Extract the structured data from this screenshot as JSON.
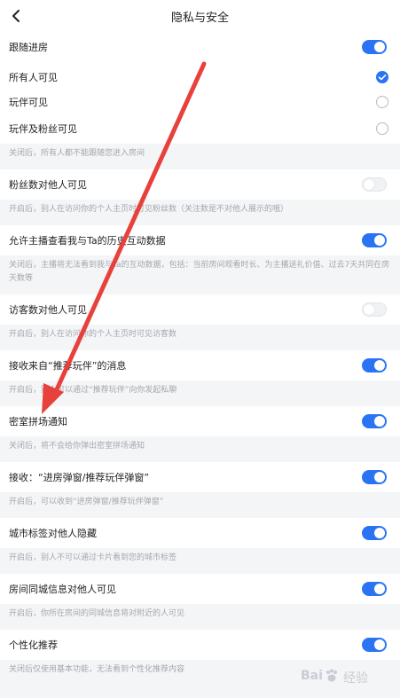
{
  "header": {
    "title": "隐私与安全",
    "back_icon": "back-chevron-icon"
  },
  "colors": {
    "accent": "#2a74f4",
    "annotation_arrow": "#e8413c"
  },
  "rows": [
    {
      "label": "跟随进房",
      "control": "toggle",
      "on": true
    },
    {
      "label": "所有人可见",
      "control": "radio",
      "checked": true
    },
    {
      "label": "玩伴可见",
      "control": "radio",
      "checked": false
    },
    {
      "label": "玩伴及粉丝可见",
      "control": "radio",
      "checked": false
    },
    {
      "label": "粉丝数对他人可见",
      "control": "toggle",
      "on": false
    },
    {
      "label": "允许主播查看我与Ta的历史互动数据",
      "control": "toggle",
      "on": true
    },
    {
      "label": "访客数对他人可见",
      "control": "toggle",
      "on": false
    },
    {
      "label": "接收来自“推荐玩伴”的消息",
      "control": "toggle",
      "on": true
    },
    {
      "label": "密室拼场通知",
      "control": "toggle",
      "on": true
    },
    {
      "label": "接收：“进房弹窗/推荐玩伴弹窗”",
      "control": "toggle",
      "on": true
    },
    {
      "label": "城市标签对他人隐藏",
      "control": "toggle",
      "on": true
    },
    {
      "label": "房间同城信息对他人可见",
      "control": "toggle",
      "on": true
    },
    {
      "label": "个性化推荐",
      "control": "toggle",
      "on": true
    }
  ],
  "descriptions": [
    "关闭后，所有人都不能跟随您进入房间",
    "开启后，别人在访问你的个人主页时可见粉丝数（关注数是不对他人展示的哦）",
    "关闭后，主播将无法看到我与Ta的互动数据，包括：当前房间观看时长、为主播送礼价值、过去7天共同在房天数等",
    "开启后，别人在访问你的个人主页时可见访客数",
    "开启后，别人可以通过“推荐玩伴”向你发起私聊",
    "关闭后，将不会给你弹出密室拼场通知",
    "开启后，可以收到“进房弹窗/推荐玩伴弹窗”",
    "开启后，别人不可以通过卡片看到您的城市标签",
    "开启后，你所在房间的同城信息将对附近的人可见",
    "关闭后仅使用基本功能，无法看到个性化推荐内容"
  ],
  "watermark": {
    "brand": "Bai",
    "suffix": "经验"
  }
}
